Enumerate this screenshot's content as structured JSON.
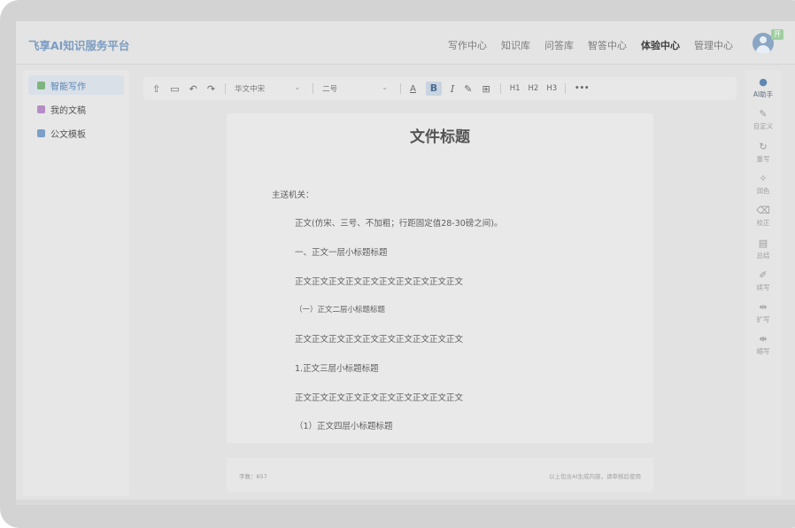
{
  "header": {
    "app_title": "飞享AI知识服务平台",
    "nav": [
      {
        "label": "写作中心",
        "active": false
      },
      {
        "label": "知识库",
        "active": false
      },
      {
        "label": "问答库",
        "active": false
      },
      {
        "label": "智答中心",
        "active": false
      },
      {
        "label": "体验中心",
        "active": true
      },
      {
        "label": "管理中心",
        "active": false
      }
    ],
    "avatar_badge": "开"
  },
  "sidebar": {
    "items": [
      {
        "label": "智能写作",
        "icon": "edit-icon",
        "active": true
      },
      {
        "label": "我的文稿",
        "icon": "document-icon",
        "active": false
      },
      {
        "label": "公文模板",
        "icon": "template-icon",
        "active": false
      }
    ]
  },
  "toolbar": {
    "export_icon": "⇧",
    "save_icon": "▭",
    "undo_icon": "↶",
    "redo_icon": "↷",
    "font_select": "华文中宋",
    "size_select": "二号",
    "font_color": "A",
    "bold": "B",
    "italic": "I",
    "highlight_icon": "✎",
    "table_icon": "⊞",
    "h1": "H1",
    "h2": "H2",
    "h3": "H3",
    "more": "•••"
  },
  "document": {
    "title": "文件标题",
    "lines": [
      "主送机关：",
      "正文(仿宋、三号、不加粗；行距固定值28-30磅之间)。",
      "一、正文一层小标题标题",
      "正文正文正文正文正文正文正文正文正文正文",
      "（一）正文二层小标题标题",
      "正文正文正文正文正文正文正文正文正文正文",
      "1.正文三层小标题标题",
      "正文正文正文正文正文正文正文正文正文正文",
      "（1）正文四层小标题标题"
    ]
  },
  "footer": {
    "word_count": "字数：657",
    "disclaimer": "以上包含AI生成内容，请审核后使用"
  },
  "right_tools": [
    {
      "label": "AI助手",
      "icon": "ai-assistant-icon",
      "glyph": "●",
      "active": true
    },
    {
      "label": "自定义",
      "icon": "custom-icon",
      "glyph": "✎",
      "active": false
    },
    {
      "label": "重写",
      "icon": "rewrite-icon",
      "glyph": "↻",
      "active": false
    },
    {
      "label": "润色",
      "icon": "polish-icon",
      "glyph": "✧",
      "active": false
    },
    {
      "label": "校正",
      "icon": "correct-icon",
      "glyph": "⌫",
      "active": false
    },
    {
      "label": "总结",
      "icon": "summary-icon",
      "glyph": "▤",
      "active": false
    },
    {
      "label": "续写",
      "icon": "continue-icon",
      "glyph": "✐",
      "active": false
    },
    {
      "label": "扩写",
      "icon": "expand-icon",
      "glyph": "⇹",
      "active": false
    },
    {
      "label": "缩写",
      "icon": "shrink-icon",
      "glyph": "⇼",
      "active": false
    }
  ]
}
